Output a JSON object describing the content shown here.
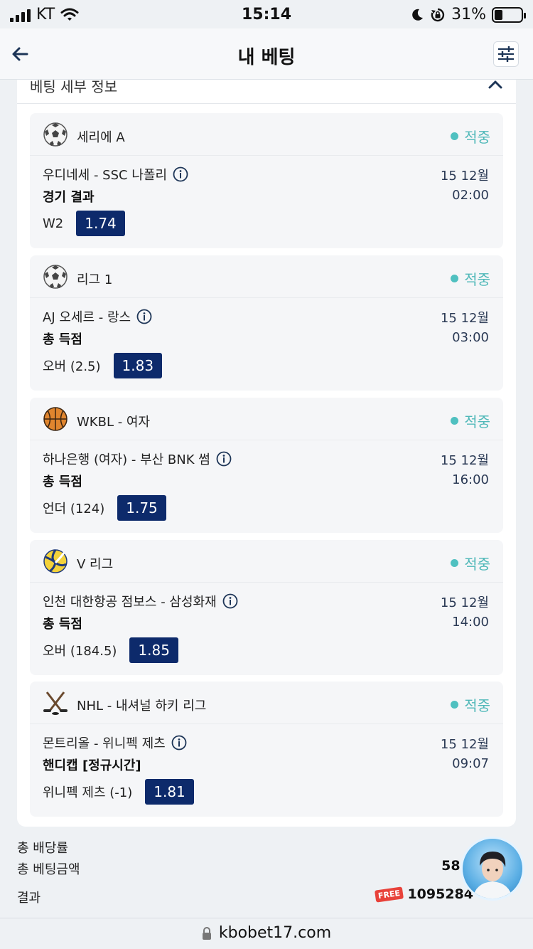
{
  "status_bar": {
    "carrier": "KT",
    "time": "15:14",
    "battery": "31%",
    "battery_level": 0.31
  },
  "header": {
    "title": "내 베팅"
  },
  "details": {
    "title": "베팅 세부 정보"
  },
  "bets": [
    {
      "sport_icon": "soccer-ball-icon",
      "league": "세리에 A",
      "status": "적중",
      "match": "우디네세 - SSC 나폴리",
      "market": "경기 결과",
      "pick": "W2",
      "odds": "1.74",
      "date": "15 12월",
      "time": "02:00"
    },
    {
      "sport_icon": "soccer-ball-icon",
      "league": "리그 1",
      "status": "적중",
      "match": "AJ 오세르 - 랑스",
      "market": "총 득점",
      "pick": "오버 (2.5)",
      "odds": "1.83",
      "date": "15 12월",
      "time": "03:00"
    },
    {
      "sport_icon": "basketball-icon",
      "league": "WKBL - 여자",
      "status": "적중",
      "match": "하나은행 (여자) - 부산 BNK 썸",
      "market": "총 득점",
      "pick": "언더 (124)",
      "odds": "1.75",
      "date": "15 12월",
      "time": "16:00"
    },
    {
      "sport_icon": "volleyball-icon",
      "league": "V 리그",
      "status": "적중",
      "match": "인천 대한항공 점보스 - 삼성화재",
      "market": "총 득점",
      "pick": "오버 (184.5)",
      "odds": "1.85",
      "date": "15 12월",
      "time": "14:00"
    },
    {
      "sport_icon": "hockey-sticks-icon",
      "league": "NHL - 내셔널 하키 리그",
      "status": "적중",
      "match": "몬트리올 - 위니펙 제츠",
      "market": "핸디캡 [정규시간]",
      "pick": "위니펙 제츠 (-1)",
      "odds": "1.81",
      "date": "15 12월",
      "time": "09:07"
    }
  ],
  "summary": {
    "total_odds_label": "총 배당률",
    "total_odds_value": "",
    "total_stake_label": "총 베팅금액",
    "total_stake_value": "58,7",
    "result_label": "결과",
    "result_badge": "FREE",
    "result_value": "1095284"
  },
  "browser": {
    "url": "kbobet17.com"
  },
  "colors": {
    "odds_badge": "#0d2a6b",
    "status_win": "#4fb8b8"
  }
}
